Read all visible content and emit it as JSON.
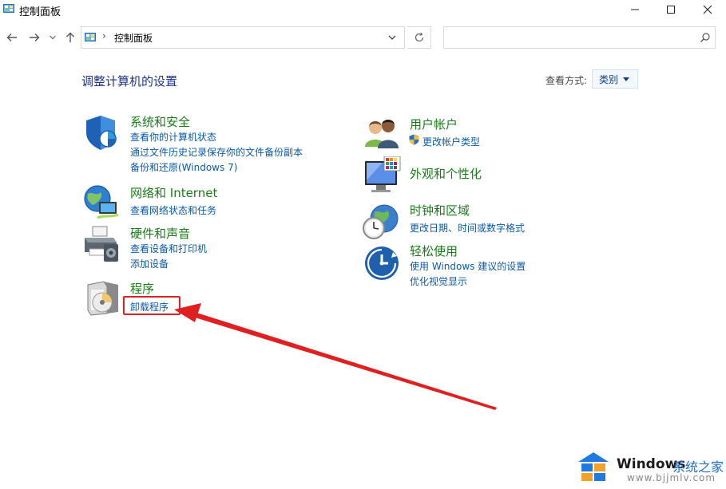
{
  "window": {
    "title": "控制面板",
    "controls": {
      "minimize_icon": "minimize-icon",
      "maximize_icon": "maximize-icon",
      "close_icon": "close-icon"
    }
  },
  "nav": {
    "back_icon": "back-arrow-icon",
    "forward_icon": "forward-arrow-icon",
    "recent_icon": "chevron-down-icon",
    "up_icon": "up-arrow-icon",
    "breadcrumb": [
      "控制面板"
    ],
    "refresh_icon": "refresh-icon",
    "search": {
      "value": "",
      "placeholder": ""
    }
  },
  "main": {
    "heading": "调整计算机的设置",
    "view_by_label": "查看方式:",
    "view_by_value": "类别"
  },
  "categories": {
    "security": {
      "title": "系统和安全",
      "icon": "shield-icon",
      "links": [
        "查看你的计算机状态",
        "通过文件历史记录保存你的文件备份副本",
        "备份和还原(Windows 7)"
      ]
    },
    "network": {
      "title": "网络和 Internet",
      "icon": "network-globe-icon",
      "links": [
        "查看网络状态和任务"
      ]
    },
    "hardware": {
      "title": "硬件和声音",
      "icon": "printer-icon",
      "links": [
        "查看设备和打印机",
        "添加设备"
      ]
    },
    "programs": {
      "title": "程序",
      "icon": "programs-disc-icon",
      "links": [
        "卸载程序"
      ]
    },
    "accounts": {
      "title": "用户帐户",
      "icon": "users-icon",
      "links": [
        "更改帐户类型"
      ],
      "link_icon": "uac-shield-icon"
    },
    "appearance": {
      "title": "外观和个性化",
      "icon": "monitor-palette-icon",
      "links": []
    },
    "clock": {
      "title": "时钟和区域",
      "icon": "clock-globe-icon",
      "links": [
        "更改日期、时间或数字格式"
      ]
    },
    "ease": {
      "title": "轻松使用",
      "icon": "ease-of-access-icon",
      "links": [
        "使用 Windows 建议的设置",
        "优化视觉显示"
      ]
    }
  },
  "annotation": {
    "highlight_color": "#e02020"
  },
  "watermark": {
    "brand": "Windows",
    "brand_cn": "系统之家",
    "url": "www.bjjmlv.com"
  },
  "colors": {
    "category_title": "#1a7a1a",
    "link": "#0b5aa8",
    "heading": "#1e3287"
  }
}
